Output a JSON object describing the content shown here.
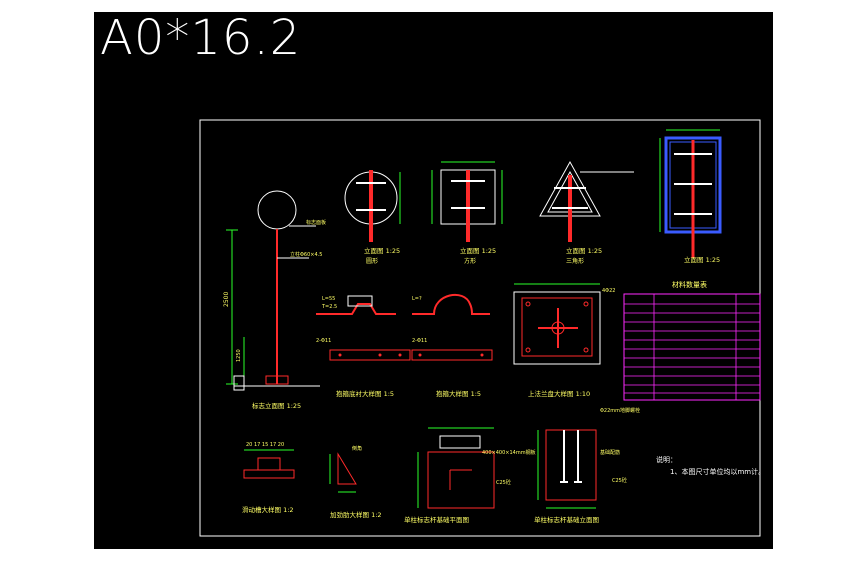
{
  "sheet": {
    "title": "A0*16.2",
    "colors": {
      "background": "#000000",
      "frame": "#ffffff",
      "sign_red": "#ff2a2a",
      "sign_blue": "#3a5bff",
      "table_magenta": "#ff2aff",
      "dimension": "#2aff2a",
      "text": "#ffff66"
    }
  },
  "labels": {
    "circle_sign_view": "立面图 1:25",
    "circle_sign_sub": "圆形",
    "rect_sign_view": "立面图 1:25",
    "rect_sign_sub": "方形",
    "tri_sign_view": "立面图 1:25",
    "tri_sign_sub": "三角形",
    "blue_sign_view": "立面图 1:25",
    "column_label": "标志立面图 1:25",
    "bracket_detail": "抱箍底衬大样图 1:5",
    "hoop_detail": "抱箍大样图 1:5",
    "flange_detail": "上法兰盘大样图 1:10",
    "slide_detail": "滑动槽大样图 1:2",
    "rib_detail": "加劲肋大样图 1:2",
    "found_plan": "单柱标志杆基础平面图",
    "found_elev": "单柱标志杆基础立面图",
    "table_title": "材料数量表",
    "notes_title": "说明：",
    "notes_line1": "1、本图尺寸单位均以mm计。"
  }
}
